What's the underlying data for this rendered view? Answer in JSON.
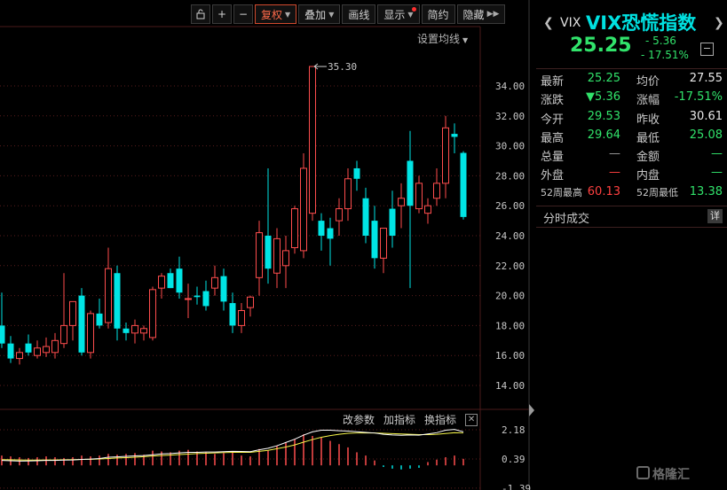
{
  "toolbar": {
    "items": [
      {
        "name": "lock-icon",
        "label": "🔓"
      },
      {
        "name": "plus-icon",
        "label": "+"
      },
      {
        "name": "minus-icon",
        "label": "−"
      },
      {
        "name": "fq-button",
        "label": "复权",
        "caret": true,
        "active": true
      },
      {
        "name": "overlay-button",
        "label": "叠加",
        "caret": true
      },
      {
        "name": "draw-button",
        "label": "画线"
      },
      {
        "name": "display-button",
        "label": "显示",
        "caret": true,
        "dot": true
      },
      {
        "name": "simple-button",
        "label": "简约"
      },
      {
        "name": "hide-button",
        "label": "隐藏",
        "more": true
      }
    ]
  },
  "ma_setting": {
    "label": "设置均线"
  },
  "indicator_bar": {
    "change_params": "改参数",
    "add_indicator": "加指标",
    "switch_indicator": "换指标",
    "close_icon": "✕"
  },
  "quote": {
    "code": "VIX",
    "name": "VIX恐慌指数",
    "price": "25.25",
    "change": "- 5.36",
    "change_pct": "- 17.51%",
    "minus_btn": "−",
    "left_arrow": "❮",
    "right_arrow": "❯"
  },
  "stats": [
    {
      "l1": "最新",
      "v1": "25.25",
      "c1": "green",
      "l2": "均价",
      "v2": "27.55",
      "c2": "white"
    },
    {
      "l1": "涨跌",
      "v1": "▼5.36",
      "c1": "green",
      "l2": "涨幅",
      "v2": "-17.51%",
      "c2": "green"
    },
    {
      "l1": "今开",
      "v1": "29.53",
      "c1": "green",
      "l2": "昨收",
      "v2": "30.61",
      "c2": "white"
    },
    {
      "l1": "最高",
      "v1": "29.64",
      "c1": "green",
      "l2": "最低",
      "v2": "25.08",
      "c2": "green"
    },
    {
      "l1": "总量",
      "v1": "—",
      "c1": "grey",
      "l2": "金额",
      "v2": "—",
      "c2": "green"
    },
    {
      "l1": "外盘",
      "v1": "—",
      "c1": "red",
      "l2": "内盘",
      "v2": "—",
      "c2": "green"
    },
    {
      "l1": "52周最高",
      "v1": "60.13",
      "c1": "red",
      "l2": "52周最低",
      "v2": "13.38",
      "c2": "green",
      "small": true
    }
  ],
  "trades": {
    "title": "分时成交",
    "detail": "详"
  },
  "watermark": {
    "text": "格隆汇"
  },
  "colors": {
    "up": "#ff4d4d",
    "down": "#00e5e5",
    "grid": "#5a1c1c",
    "ma": "#f5f54a",
    "ma2": "#ffffff"
  },
  "chart_data": [
    {
      "type": "candlestick",
      "title": "VIX",
      "ylim": [
        13,
        36
      ],
      "yticks": [
        "14.00",
        "16.00",
        "18.00",
        "20.00",
        "22.00",
        "24.00",
        "26.00",
        "28.00",
        "30.00",
        "32.00",
        "34.00"
      ],
      "max_annotation": {
        "label": "35.30",
        "value": 35.3
      },
      "candles": [
        {
          "o": 18.0,
          "h": 20.2,
          "l": 16.5,
          "c": 16.8
        },
        {
          "o": 16.8,
          "h": 17.3,
          "l": 15.5,
          "c": 15.8
        },
        {
          "o": 15.8,
          "h": 16.5,
          "l": 15.4,
          "c": 16.2
        },
        {
          "o": 16.8,
          "h": 17.4,
          "l": 16.0,
          "c": 16.2
        },
        {
          "o": 16.0,
          "h": 17.0,
          "l": 15.8,
          "c": 16.5
        },
        {
          "o": 16.2,
          "h": 17.2,
          "l": 15.9,
          "c": 16.6
        },
        {
          "o": 16.2,
          "h": 17.5,
          "l": 15.8,
          "c": 17.0
        },
        {
          "o": 16.8,
          "h": 21.5,
          "l": 16.5,
          "c": 18.0
        },
        {
          "o": 18.0,
          "h": 19.2,
          "l": 17.0,
          "c": 19.6
        },
        {
          "o": 20.0,
          "h": 20.5,
          "l": 16.0,
          "c": 16.2
        },
        {
          "o": 16.2,
          "h": 19.0,
          "l": 15.8,
          "c": 18.8
        },
        {
          "o": 18.8,
          "h": 19.8,
          "l": 17.8,
          "c": 18.0
        },
        {
          "o": 18.2,
          "h": 23.2,
          "l": 17.8,
          "c": 21.8
        },
        {
          "o": 21.5,
          "h": 22.0,
          "l": 17.0,
          "c": 17.8
        },
        {
          "o": 17.8,
          "h": 18.2,
          "l": 17.0,
          "c": 17.5
        },
        {
          "o": 17.5,
          "h": 18.4,
          "l": 16.8,
          "c": 18.0
        },
        {
          "o": 17.5,
          "h": 18.0,
          "l": 17.0,
          "c": 17.8
        },
        {
          "o": 17.2,
          "h": 20.6,
          "l": 17.0,
          "c": 20.4
        },
        {
          "o": 20.5,
          "h": 21.5,
          "l": 19.8,
          "c": 21.3
        },
        {
          "o": 21.5,
          "h": 21.8,
          "l": 20.5,
          "c": 20.5
        },
        {
          "o": 21.8,
          "h": 22.6,
          "l": 19.8,
          "c": 20.2
        },
        {
          "o": 19.8,
          "h": 20.8,
          "l": 18.5,
          "c": 19.8
        },
        {
          "o": 20.0,
          "h": 20.6,
          "l": 19.4,
          "c": 19.9
        },
        {
          "o": 20.3,
          "h": 21.0,
          "l": 19.0,
          "c": 19.3
        },
        {
          "o": 20.5,
          "h": 22.0,
          "l": 20.0,
          "c": 21.2
        },
        {
          "o": 21.3,
          "h": 21.8,
          "l": 19.0,
          "c": 19.6
        },
        {
          "o": 19.5,
          "h": 20.2,
          "l": 17.5,
          "c": 18.0
        },
        {
          "o": 18.0,
          "h": 19.5,
          "l": 17.5,
          "c": 19.0
        },
        {
          "o": 19.2,
          "h": 20.0,
          "l": 18.6,
          "c": 19.9
        },
        {
          "o": 21.2,
          "h": 25.0,
          "l": 20.0,
          "c": 24.2
        },
        {
          "o": 24.0,
          "h": 28.5,
          "l": 20.8,
          "c": 21.8
        },
        {
          "o": 21.5,
          "h": 24.5,
          "l": 20.5,
          "c": 23.8
        },
        {
          "o": 22.0,
          "h": 24.0,
          "l": 20.5,
          "c": 23.0
        },
        {
          "o": 23.2,
          "h": 26.0,
          "l": 22.8,
          "c": 25.8
        },
        {
          "o": 23.0,
          "h": 29.5,
          "l": 22.5,
          "c": 28.5
        },
        {
          "o": 25.5,
          "h": 35.3,
          "l": 25.0,
          "c": 35.3
        },
        {
          "o": 25.0,
          "h": 25.5,
          "l": 23.0,
          "c": 24.0
        },
        {
          "o": 24.5,
          "h": 25.2,
          "l": 22.0,
          "c": 23.8
        },
        {
          "o": 25.0,
          "h": 26.5,
          "l": 24.0,
          "c": 25.8
        },
        {
          "o": 25.8,
          "h": 28.5,
          "l": 25.0,
          "c": 27.8
        },
        {
          "o": 28.5,
          "h": 29.0,
          "l": 27.0,
          "c": 27.8
        },
        {
          "o": 26.5,
          "h": 27.2,
          "l": 23.5,
          "c": 24.0
        },
        {
          "o": 25.0,
          "h": 26.0,
          "l": 21.8,
          "c": 22.5
        },
        {
          "o": 22.5,
          "h": 24.0,
          "l": 21.5,
          "c": 24.5
        },
        {
          "o": 25.8,
          "h": 27.0,
          "l": 23.2,
          "c": 24.0
        },
        {
          "o": 26.0,
          "h": 27.5,
          "l": 24.5,
          "c": 26.5
        },
        {
          "o": 29.0,
          "h": 31.0,
          "l": 20.5,
          "c": 26.0
        },
        {
          "o": 25.8,
          "h": 28.0,
          "l": 25.5,
          "c": 27.5
        },
        {
          "o": 25.5,
          "h": 26.5,
          "l": 24.8,
          "c": 26.0
        },
        {
          "o": 26.5,
          "h": 28.5,
          "l": 26.0,
          "c": 27.5
        },
        {
          "o": 27.5,
          "h": 32.0,
          "l": 26.5,
          "c": 31.2
        },
        {
          "o": 30.8,
          "h": 31.5,
          "l": 29.5,
          "c": 30.6
        },
        {
          "o": 29.53,
          "h": 29.64,
          "l": 25.08,
          "c": 25.25
        }
      ]
    },
    {
      "type": "bar",
      "title": "indicator",
      "ylim": [
        -1.39,
        2.6
      ],
      "yticks": [
        "2.18",
        "0.39",
        "-1.39"
      ],
      "values": [
        0.6,
        0.55,
        0.5,
        0.45,
        0.5,
        0.55,
        0.5,
        0.45,
        0.5,
        0.6,
        0.55,
        0.6,
        0.7,
        0.65,
        0.7,
        0.75,
        0.65,
        0.9,
        0.85,
        0.8,
        0.9,
        0.95,
        0.85,
        0.8,
        0.7,
        0.75,
        0.8,
        0.6,
        0.55,
        1.0,
        0.9,
        1.2,
        1.4,
        1.6,
        1.9,
        1.8,
        1.7,
        1.5,
        1.3,
        1.1,
        0.8,
        0.6,
        0.3,
        -0.1,
        -0.2,
        -0.25,
        -0.2,
        -0.15,
        0.2,
        0.35,
        0.5,
        0.6,
        0.4
      ],
      "line1": [
        0.3,
        0.28,
        0.26,
        0.27,
        0.28,
        0.3,
        0.3,
        0.32,
        0.33,
        0.36,
        0.38,
        0.42,
        0.5,
        0.52,
        0.55,
        0.58,
        0.6,
        0.65,
        0.7,
        0.72,
        0.76,
        0.8,
        0.8,
        0.82,
        0.82,
        0.84,
        0.86,
        0.85,
        0.84,
        0.95,
        1.05,
        1.2,
        1.4,
        1.6,
        1.85,
        2.05,
        2.15,
        2.15,
        2.12,
        2.1,
        2.06,
        2.02,
        1.98,
        1.9,
        1.86,
        1.84,
        1.86,
        1.85,
        1.92,
        2.0,
        2.15,
        2.2,
        2.05
      ],
      "line2": [
        0.35,
        0.34,
        0.33,
        0.32,
        0.32,
        0.33,
        0.33,
        0.34,
        0.35,
        0.36,
        0.37,
        0.39,
        0.42,
        0.45,
        0.47,
        0.5,
        0.53,
        0.57,
        0.6,
        0.63,
        0.66,
        0.69,
        0.72,
        0.74,
        0.76,
        0.78,
        0.8,
        0.8,
        0.8,
        0.86,
        0.92,
        1.02,
        1.12,
        1.25,
        1.42,
        1.58,
        1.72,
        1.82,
        1.9,
        1.96,
        1.98,
        1.99,
        1.98,
        1.96,
        1.94,
        1.92,
        1.9,
        1.88,
        1.88,
        1.9,
        1.95,
        2.0,
        1.98
      ]
    }
  ]
}
